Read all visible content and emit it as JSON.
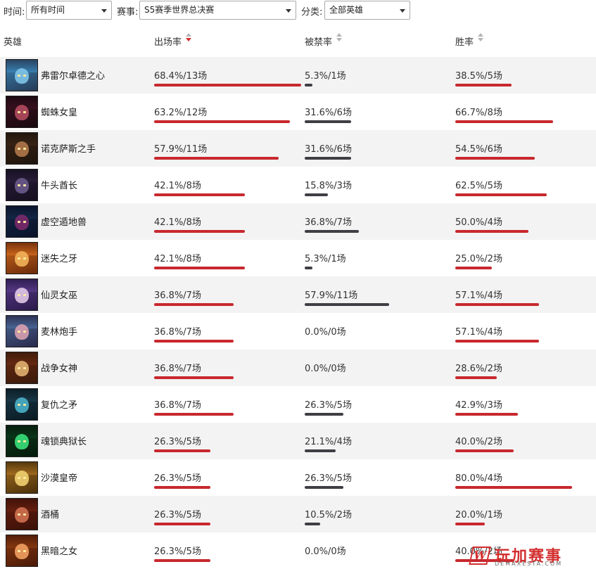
{
  "filters": [
    {
      "label": "时间:",
      "value": "所有时间"
    },
    {
      "label": "赛事:",
      "value": "S5赛季世界总决赛"
    },
    {
      "label": "分类:",
      "value": "全部英雄"
    }
  ],
  "header": {
    "hero": "英雄",
    "pick": "出场率",
    "ban": "被禁率",
    "win": "胜率"
  },
  "colors": {
    "pick_bar": "#c8282e",
    "ban_bar": "#3e3e44",
    "win_bar": "#c8282e",
    "active_sort": "#d32f2f"
  },
  "rows": [
    {
      "name": "弗雷尔卓德之心",
      "pick_text": "68.4%/13场",
      "ban_text": "5.3%/1场",
      "win_text": "38.5%/5场",
      "pick": 68.4,
      "ban": 5.3,
      "win": 38.5,
      "colors": [
        "#3a86b8",
        "#7fc4e8",
        "#263a55"
      ]
    },
    {
      "name": "蜘蛛女皇",
      "pick_text": "63.2%/12场",
      "ban_text": "31.6%/6场",
      "win_text": "66.7%/8场",
      "pick": 63.2,
      "ban": 31.6,
      "win": 66.7,
      "colors": [
        "#3b1020",
        "#b24a5e",
        "#1a0a10"
      ]
    },
    {
      "name": "诺克萨斯之手",
      "pick_text": "57.9%/11场",
      "ban_text": "31.6%/6场",
      "win_text": "54.5%/6场",
      "pick": 57.9,
      "ban": 31.6,
      "win": 54.5,
      "colors": [
        "#3a2416",
        "#b0784a",
        "#1e140c"
      ]
    },
    {
      "name": "牛头酋长",
      "pick_text": "42.1%/8场",
      "ban_text": "15.8%/3场",
      "win_text": "62.5%/5场",
      "pick": 42.1,
      "ban": 15.8,
      "win": 62.5,
      "colors": [
        "#2a1e3c",
        "#6a5a8c",
        "#15101f"
      ]
    },
    {
      "name": "虚空遁地兽",
      "pick_text": "42.1%/8场",
      "ban_text": "36.8%/7场",
      "win_text": "50.0%/4场",
      "pick": 42.1,
      "ban": 36.8,
      "win": 50.0,
      "colors": [
        "#142848",
        "#7a2a6a",
        "#0a1228"
      ]
    },
    {
      "name": "迷失之牙",
      "pick_text": "42.1%/8场",
      "ban_text": "5.3%/1场",
      "win_text": "25.0%/2场",
      "pick": 42.1,
      "ban": 5.3,
      "win": 25.0,
      "colors": [
        "#d06a1e",
        "#f2b25a",
        "#6a2a0a"
      ]
    },
    {
      "name": "仙灵女巫",
      "pick_text": "36.8%/7场",
      "ban_text": "57.9%/11场",
      "win_text": "57.1%/4场",
      "pick": 36.8,
      "ban": 57.9,
      "win": 57.1,
      "colors": [
        "#5a3a8a",
        "#e0c8e8",
        "#2a1a4a"
      ]
    },
    {
      "name": "麦林炮手",
      "pick_text": "36.8%/7场",
      "ban_text": "0.0%/0场",
      "win_text": "57.1%/4场",
      "pick": 36.8,
      "ban": 0.0,
      "win": 57.1,
      "colors": [
        "#4a6a9a",
        "#d8a0b0",
        "#2a2a4a"
      ]
    },
    {
      "name": "战争女神",
      "pick_text": "36.8%/7场",
      "ban_text": "0.0%/0场",
      "win_text": "28.6%/2场",
      "pick": 36.8,
      "ban": 0.0,
      "win": 28.6,
      "colors": [
        "#6a2a12",
        "#e0b070",
        "#3a1a0a"
      ]
    },
    {
      "name": "复仇之矛",
      "pick_text": "36.8%/7场",
      "ban_text": "26.3%/5场",
      "win_text": "42.9%/3场",
      "pick": 36.8,
      "ban": 26.3,
      "win": 42.9,
      "colors": [
        "#1a3a4a",
        "#4ab0c8",
        "#0a1a22"
      ]
    },
    {
      "name": "魂锁典狱长",
      "pick_text": "26.3%/5场",
      "ban_text": "21.1%/4场",
      "win_text": "40.0%/2场",
      "pick": 26.3,
      "ban": 21.1,
      "win": 40.0,
      "colors": [
        "#0a3a1a",
        "#3ae07a",
        "#061a0c"
      ]
    },
    {
      "name": "沙漠皇帝",
      "pick_text": "26.3%/5场",
      "ban_text": "26.3%/5场",
      "win_text": "80.0%/4场",
      "pick": 26.3,
      "ban": 26.3,
      "win": 80.0,
      "colors": [
        "#a87020",
        "#f0d070",
        "#4a300a"
      ]
    },
    {
      "name": "酒桶",
      "pick_text": "26.3%/5场",
      "ban_text": "10.5%/2场",
      "win_text": "20.0%/1场",
      "pick": 26.3,
      "ban": 10.5,
      "win": 20.0,
      "colors": [
        "#6a2010",
        "#d07050",
        "#3a1008"
      ]
    },
    {
      "name": "黑暗之女",
      "pick_text": "26.3%/5场",
      "ban_text": "0.0%/0场",
      "win_text": "40.0%/2场",
      "pick": 26.3,
      "ban": 0.0,
      "win": 40.0,
      "colors": [
        "#8a3a10",
        "#f0a060",
        "#4a1a08"
      ]
    }
  ],
  "watermark": {
    "logo": "W",
    "title": "玩加赛事",
    "subtitle": "DEMAXESTA.COM"
  }
}
